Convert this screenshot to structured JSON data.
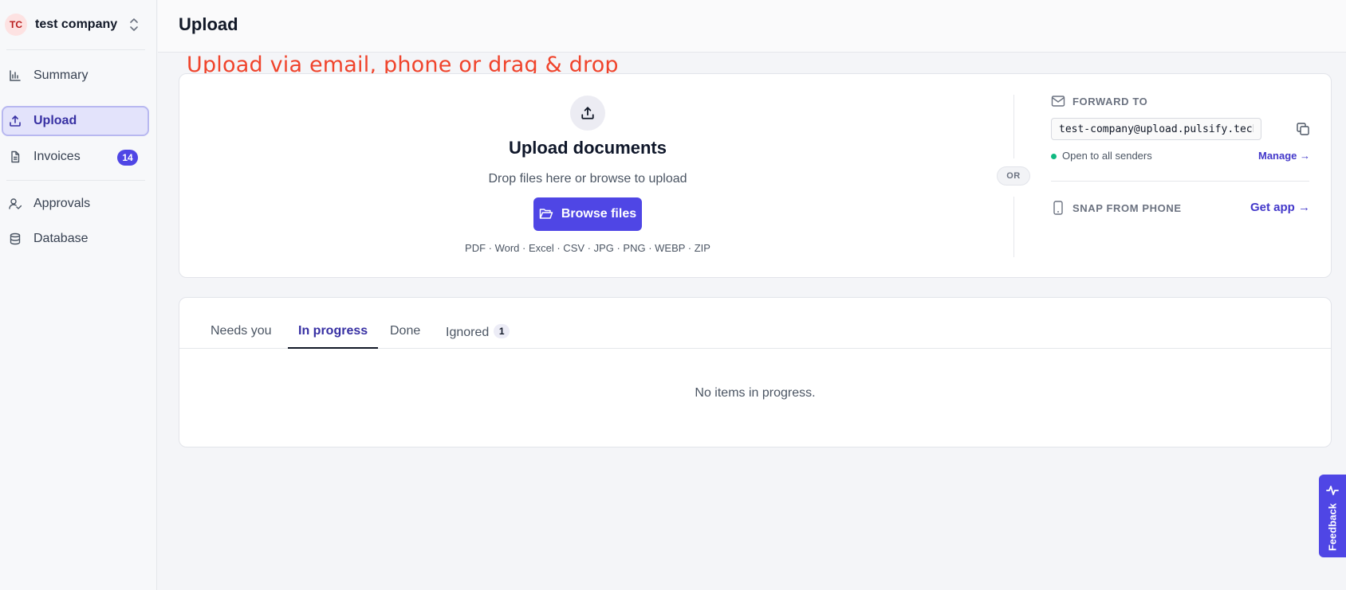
{
  "sidebar": {
    "company": {
      "initials": "TC",
      "name": "test company"
    },
    "items": [
      {
        "label": "Summary",
        "icon": "bar-chart-icon"
      },
      {
        "label": "Upload",
        "icon": "upload-icon",
        "active": true
      },
      {
        "label": "Invoices",
        "icon": "document-icon",
        "badge": "14"
      },
      {
        "label": "Approvals",
        "icon": "user-check-icon"
      },
      {
        "label": "Database",
        "icon": "database-icon"
      }
    ]
  },
  "header": {
    "title": "Upload"
  },
  "annotation": "Upload via email, phone or drag & drop",
  "upload": {
    "title": "Upload documents",
    "subtitle": "Drop files here or browse to upload",
    "browse_label": "Browse files",
    "file_types": "PDF · Word · Excel · CSV · JPG · PNG · WEBP · ZIP",
    "or_label": "OR"
  },
  "forward": {
    "label": "FORWARD TO",
    "email": "test-company@upload.pulsify.tech",
    "status": "Open to all senders",
    "manage_label": "Manage →"
  },
  "phone": {
    "label": "SNAP FROM PHONE",
    "get_app_label": "Get app →"
  },
  "tabs": {
    "items": [
      {
        "label": "Needs you"
      },
      {
        "label": "In progress",
        "active": true
      },
      {
        "label": "Done"
      },
      {
        "label": "Ignored",
        "count": "1"
      }
    ],
    "empty_message": "No items in progress."
  },
  "feedback": {
    "label": "Feedback"
  },
  "colors": {
    "accent": "#4f46e5",
    "annotation": "#f0442c",
    "status_green": "#10b981"
  }
}
